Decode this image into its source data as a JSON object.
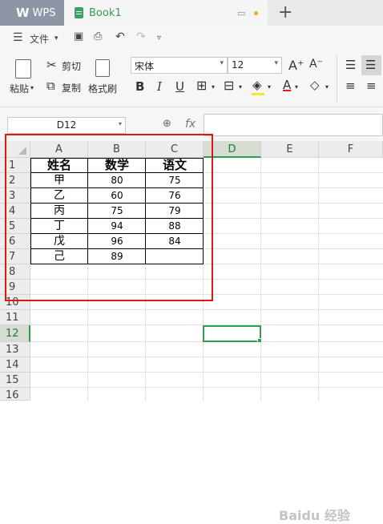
{
  "tabs": {
    "app": "WPS",
    "book": "Book1",
    "new_tab": "+"
  },
  "menu": {
    "file": "文件"
  },
  "ribbon": {
    "paste": "粘贴",
    "cut": "剪切",
    "copy": "复制",
    "format_painter": "格式刷",
    "font_name": "宋体",
    "font_size": "12",
    "increase_font": "A⁺",
    "decrease_font": "A⁻",
    "bold": "B",
    "italic": "I",
    "underline": "U",
    "font_color": "A"
  },
  "formula": {
    "name_box": "D12",
    "fx": "fx",
    "value": ""
  },
  "columns": [
    "A",
    "B",
    "C",
    "D",
    "E",
    "F"
  ],
  "active_column": "D",
  "rows": [
    "1",
    "2",
    "3",
    "4",
    "5",
    "6",
    "7",
    "8",
    "9",
    "10",
    "11",
    "12",
    "13",
    "14",
    "15",
    "16"
  ],
  "active_row": "12",
  "table": {
    "headers": [
      "姓名",
      "数学",
      "语文"
    ],
    "rows": [
      [
        "甲",
        "80",
        "75"
      ],
      [
        "乙",
        "60",
        "76"
      ],
      [
        "丙",
        "75",
        "79"
      ],
      [
        "丁",
        "94",
        "88"
      ],
      [
        "戊",
        "96",
        "84"
      ],
      [
        "己",
        "89",
        ""
      ]
    ]
  },
  "selected_cell": "D12",
  "colors": {
    "accent_green": "#2f9d52",
    "highlight_red": "#e01515"
  },
  "watermark": "Baidu 经验"
}
